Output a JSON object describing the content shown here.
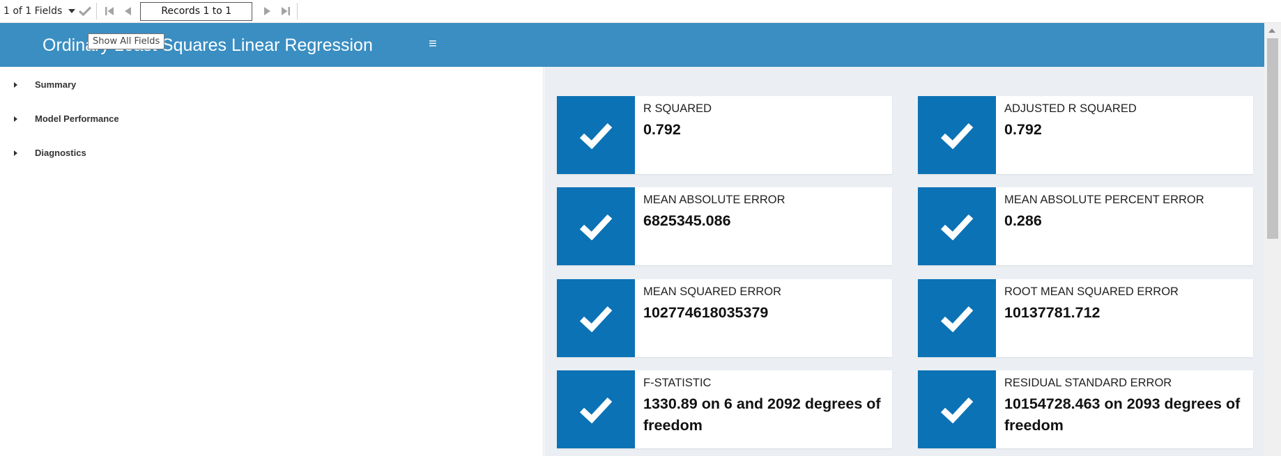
{
  "toolbar": {
    "fields_label": "1 of 1 Fields",
    "records_label": "Records 1 to 1",
    "tooltip": "Show All Fields"
  },
  "header": {
    "title": "Ordinary Least Squares Linear Regression"
  },
  "sidebar": {
    "items": [
      {
        "label": "Summary"
      },
      {
        "label": "Model Performance"
      },
      {
        "label": "Diagnostics"
      }
    ]
  },
  "metrics": [
    {
      "label": "R SQUARED",
      "value": "0.792"
    },
    {
      "label": "ADJUSTED R SQUARED",
      "value": "0.792"
    },
    {
      "label": "MEAN ABSOLUTE ERROR",
      "value": "6825345.086"
    },
    {
      "label": "MEAN ABSOLUTE PERCENT ERROR",
      "value": "0.286"
    },
    {
      "label": "MEAN SQUARED ERROR",
      "value": "102774618035379"
    },
    {
      "label": "ROOT MEAN SQUARED ERROR",
      "value": "10137781.712"
    },
    {
      "label": "F-STATISTIC",
      "value": "1330.89 on 6 and 2092 degrees of freedom"
    },
    {
      "label": "RESIDUAL STANDARD ERROR",
      "value": "10154728.463 on 2093 degrees of freedom"
    }
  ],
  "icons": {
    "card_icon": "checkmark-icon",
    "header_menu": "hamburger-menu-icon"
  },
  "colors": {
    "header_bg": "#3a8ec2",
    "card_icon_bg": "#0b72b5",
    "main_bg": "#ebeff3"
  }
}
